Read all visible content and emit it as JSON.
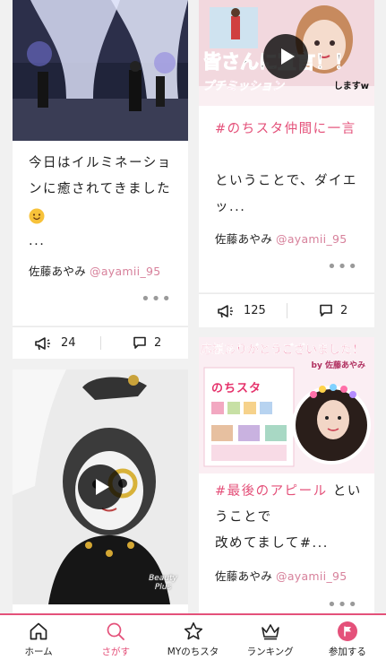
{
  "posts": [
    {
      "text_line1": "今日はイルミネーショ",
      "text_line2": "ンに癒されてきました",
      "text_line3": "...",
      "author": "佐藤あやみ",
      "handle": "@ayamii_95",
      "more": "•••",
      "likes": "24",
      "comments": "2"
    },
    {
      "overlay_caption1": "皆さんに宣言！！",
      "overlay_caption2": "プチミッション",
      "overlay_caption3": "しますw",
      "hashtag": "#のちスタ仲間に一言",
      "text_line1": "ということで、ダイエ",
      "text_line2": "ッ...",
      "author": "佐藤あやみ",
      "handle": "@ayamii_95",
      "more": "•••",
      "likes": "125",
      "comments": "2"
    },
    {
      "overlay_caption": "Beauty Plus"
    },
    {
      "banner_title": "応援ありがとうございました！",
      "banner_by": "by 佐藤あやみ",
      "banner_logo": "のちスタ",
      "hashtag": "#最後のアピール",
      "text_line1_suffix": " とい",
      "text_line2": "うことで",
      "text_line3": "改めてまして#...",
      "author": "佐藤あやみ",
      "handle": "@ayamii_95",
      "more": "•••"
    }
  ],
  "tabbar": {
    "home": "ホーム",
    "search": "さがす",
    "my": "MYのちスタ",
    "ranking": "ランキング",
    "join": "参加する"
  },
  "colors": {
    "accent": "#e4517a",
    "handle": "#d7819b"
  },
  "icons": [
    "megaphone-icon",
    "comment-icon",
    "play-icon",
    "home-icon",
    "search-icon",
    "star-icon",
    "crown-icon",
    "flag-icon",
    "more-icon"
  ]
}
